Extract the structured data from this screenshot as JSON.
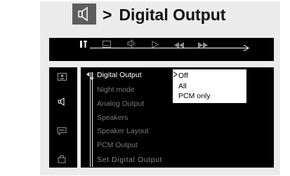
{
  "title": {
    "icon": "speaker-icon",
    "separator": ">",
    "text": "Digital Output"
  },
  "toolbar": {
    "icons": [
      "settings-icon",
      "subtitle-icon",
      "audio-icon",
      "play-icon",
      "rewind-icon",
      "fast-forward-icon"
    ]
  },
  "sidebar": {
    "icons": [
      "picture-icon",
      "speaker-icon",
      "subtitle-icon",
      "lock-icon"
    ]
  },
  "menu": {
    "items": [
      {
        "label": "Digital Output",
        "active": true
      },
      {
        "label": "Night mode",
        "active": false
      },
      {
        "label": "Analog Output",
        "active": false
      },
      {
        "label": "Speakers",
        "active": false
      },
      {
        "label": "Speaker Layout",
        "active": false
      },
      {
        "label": "PCM Output",
        "active": false
      }
    ],
    "footer": "Set Digital Output"
  },
  "options": {
    "items": [
      "Off",
      "All",
      "PCM only"
    ],
    "selected": "Off"
  },
  "colors": {
    "panel": "#000000",
    "frame": "#ececec",
    "active_text": "#ffffff",
    "inactive_text": "#7a7a7a",
    "icon_box": "#5d5d5d"
  }
}
